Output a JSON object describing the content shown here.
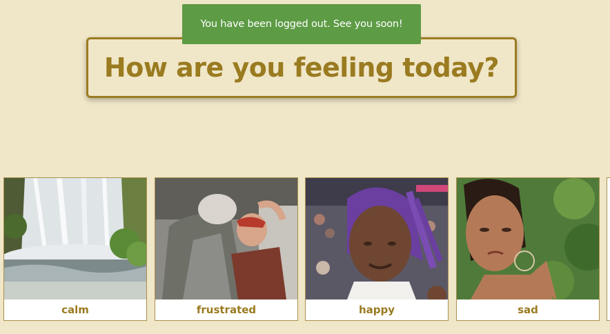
{
  "toast": {
    "message": "You have been logged out. See you soon!",
    "color": "#5d9b45"
  },
  "heading": {
    "text": "How are you feeling today?",
    "color": "#9a7b20"
  },
  "moods": [
    {
      "label": "calm"
    },
    {
      "label": "frustrated"
    },
    {
      "label": "happy"
    },
    {
      "label": "sad"
    }
  ],
  "colors": {
    "background": "#f0e6c8",
    "accent": "#9a7b20"
  }
}
